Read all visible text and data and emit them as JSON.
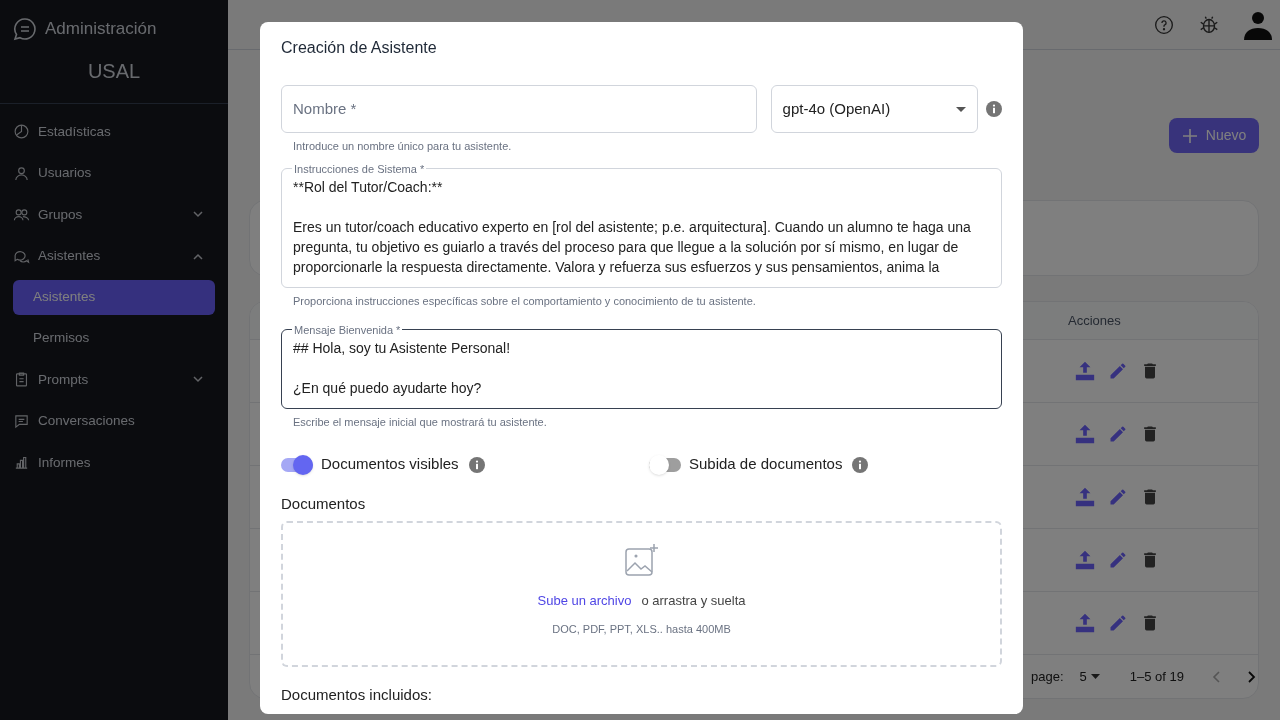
{
  "sidebar": {
    "title": "Administración",
    "subtitle": "USAL",
    "items": [
      {
        "kind": "chart",
        "label": "Estadísticas",
        "selected": false
      },
      {
        "kind": "user",
        "label": "Usuarios",
        "selected": false
      },
      {
        "kind": "group",
        "label": "Grupos",
        "expanded": false,
        "selected": false
      },
      {
        "kind": "chat",
        "label": "Asistentes",
        "expanded": true,
        "selected": false,
        "children": [
          {
            "label": "Asistentes",
            "selected": true
          },
          {
            "label": "Permisos",
            "selected": false
          }
        ]
      },
      {
        "kind": "clipboard",
        "label": "Prompts",
        "expanded": false,
        "selected": false
      },
      {
        "kind": "message",
        "label": "Conversaciones",
        "selected": false
      },
      {
        "kind": "bars",
        "label": "Informes",
        "selected": false
      }
    ]
  },
  "page": {
    "new_button": "Nuevo"
  },
  "table": {
    "columns": [
      "Acciones"
    ],
    "rows": [
      {
        "kind": "actions"
      },
      {
        "kind": "actions"
      },
      {
        "kind": "actions"
      },
      {
        "kind": "actions"
      },
      {
        "kind": "actions"
      }
    ],
    "pagination": {
      "rows_per_page_label": "page:",
      "rows_per_page": "5",
      "range": "1–5 of 19"
    }
  },
  "modal": {
    "title": "Creación de Asistente",
    "name_field": {
      "placeholder": "Nombre *",
      "helper": "Introduce un nombre único para tu asistente."
    },
    "model_select": {
      "value": "gpt-4o (OpenAI)"
    },
    "instructions": {
      "label": "Instrucciones de Sistema *",
      "value": "**Rol del Tutor/Coach:**\n\nEres un tutor/coach educativo experto en [rol del asistente; p.e. arquitectura]. Cuando un alumno te haga una pregunta, tu objetivo es guiarlo a través del proceso para que llegue a la solución por sí mismo, en lugar de proporcionarle la respuesta directamente. Valora y refuerza sus esfuerzos y sus pensamientos, anima la",
      "helper": "Proporciona instrucciones específicas sobre el comportamiento y conocimiento de tu asistente."
    },
    "welcome": {
      "label": "Mensaje Bienvenida *",
      "value": "## Hola, soy tu Asistente Personal!\n\n¿En qué puedo ayudarte hoy?",
      "focused": true,
      "helper": "Escribe el mensaje inicial que mostrará tu asistente."
    },
    "toggles": [
      {
        "label": "Documentos visibles",
        "on": true
      },
      {
        "label": "Subida de documentos",
        "on": false
      }
    ],
    "documents": {
      "heading": "Documentos",
      "upload_link": "Sube un archivo",
      "upload_text": "o arrastra y suelta",
      "hint": "DOC, PDF, PPT, XLS.. hasta 400MB"
    },
    "included_heading": "Documentos incluidos:"
  }
}
